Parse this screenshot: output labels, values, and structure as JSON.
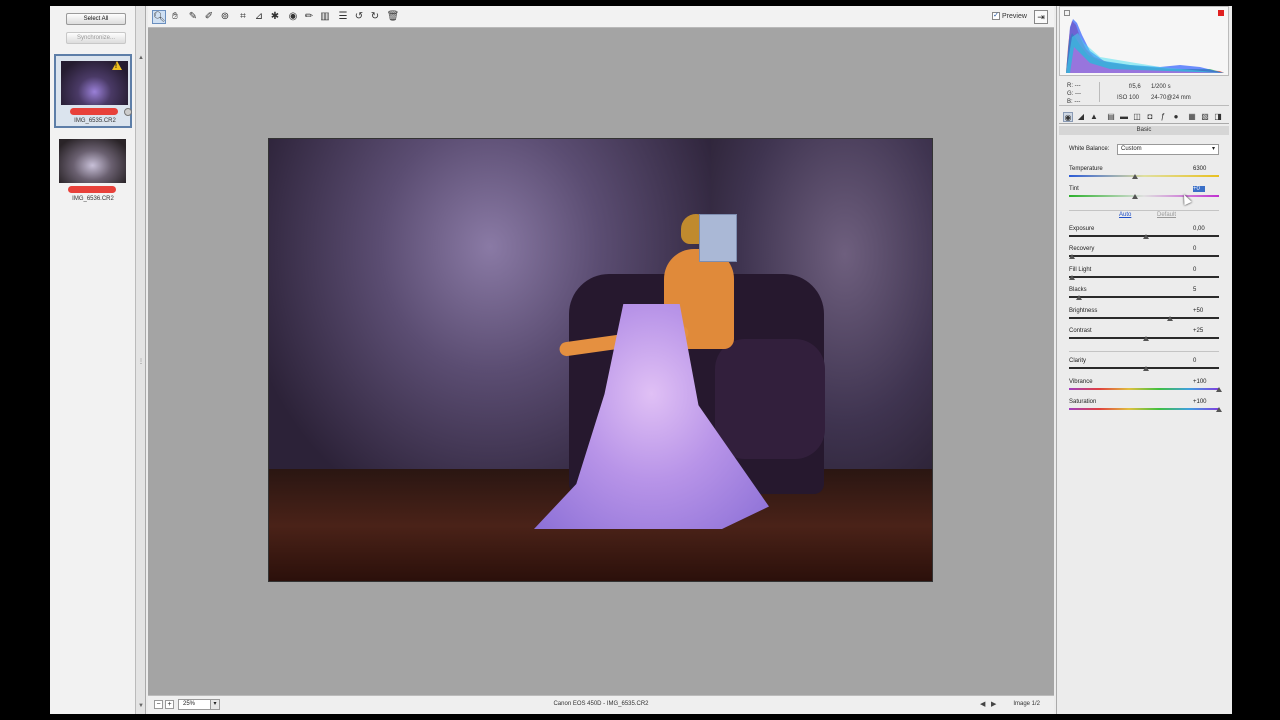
{
  "filmstrip": {
    "select_all": "Select All",
    "synchronize": "Synchronize...",
    "items": [
      {
        "caption": "IMG_6535.CR2",
        "selected": true,
        "warning": "!"
      },
      {
        "caption": "IMG_6536.CR2",
        "selected": false
      }
    ]
  },
  "toolbar": {
    "tools": [
      "zoom-icon",
      "hand-icon",
      "white-balance-icon",
      "color-sampler-icon",
      "target-adjust-icon",
      "crop-icon",
      "straighten-icon",
      "spot-removal-icon",
      "red-eye-icon",
      "adjustment-brush-icon",
      "graduated-filter-icon",
      "preferences-icon",
      "rotate-ccw-icon",
      "rotate-cw-icon",
      "trash-icon"
    ],
    "preview_label": "Preview",
    "preview_checked": true
  },
  "status": {
    "zoom": "25%",
    "camera_file": "Canon EOS 450D  -  IMG_6535.CR2",
    "image_count": "Image 1/2"
  },
  "info": {
    "r": "R:  ---",
    "g": "G:  ---",
    "b": "B:  ---",
    "aperture": "f/5,6",
    "shutter": "1/200 s",
    "iso": "ISO 100",
    "lens": "24-70@24 mm"
  },
  "panel": {
    "title": "Basic",
    "white_balance_label": "White Balance:",
    "white_balance_value": "Custom",
    "auto": "Auto",
    "default": "Default",
    "sliders": [
      {
        "label": "Temperature",
        "value": "6300",
        "pos": 0.43
      },
      {
        "label": "Tint",
        "value": "+0",
        "pos": 0.43
      },
      {
        "label": "Exposure",
        "value": "0,00",
        "pos": 0.5
      },
      {
        "label": "Recovery",
        "value": "0",
        "pos": 0.0
      },
      {
        "label": "Fill Light",
        "value": "0",
        "pos": 0.0
      },
      {
        "label": "Blacks",
        "value": "5",
        "pos": 0.05
      },
      {
        "label": "Brightness",
        "value": "+50",
        "pos": 0.67
      },
      {
        "label": "Contrast",
        "value": "+25",
        "pos": 0.5
      },
      {
        "label": "Clarity",
        "value": "0",
        "pos": 0.5
      },
      {
        "label": "Vibrance",
        "value": "+100",
        "pos": 1.0
      },
      {
        "label": "Saturation",
        "value": "+100",
        "pos": 1.0
      }
    ]
  },
  "colors": {
    "accent": "#3a6fc7",
    "rating": "#e8413a",
    "warning": "#f0c020"
  }
}
